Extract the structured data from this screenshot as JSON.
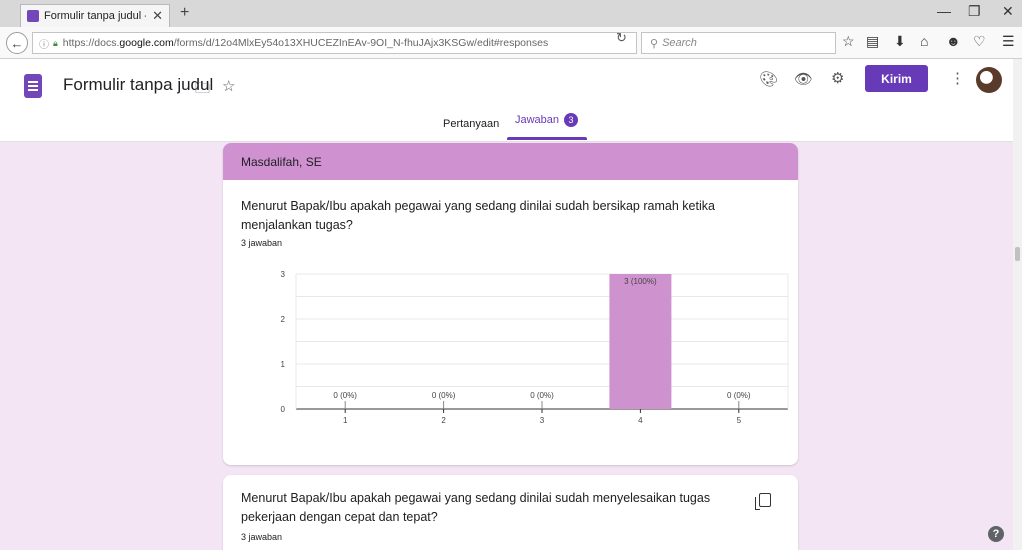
{
  "browser": {
    "tab_title": "Formulir tanpa judul - Go...",
    "tab_close": "✕",
    "new_tab": "+",
    "url_prefix": "https://docs.",
    "url_host": "google.com",
    "url_path": "/forms/d/12o4MlxEy54o13XHUCEZInEAv-9OI_N-fhuJAjx3KSGw/edit#responses",
    "search_placeholder": "Search"
  },
  "header": {
    "form_title": "Formulir tanpa judul",
    "send_label": "Kirim",
    "tab_questions": "Pertanyaan",
    "tab_responses": "Jawaban",
    "responses_badge": "3"
  },
  "cards": [
    {
      "section_title": "Masdalifah, SE",
      "question": "Menurut Bapak/Ibu apakah pegawai yang sedang dinilai sudah bersikap ramah ketika menjalankan tugas?",
      "response_count": "3 jawaban"
    },
    {
      "question": "Menurut Bapak/Ibu apakah pegawai yang sedang dinilai sudah menyelesaikan tugas pekerjaan dengan cepat dan tepat?",
      "response_count": "3 jawaban"
    }
  ],
  "colors": {
    "accent": "#673ab7",
    "section_header": "#d091d0",
    "bar": "#ce93ce",
    "background": "#f3e5f4"
  },
  "chart_data": {
    "type": "bar",
    "categories": [
      "1",
      "2",
      "3",
      "4",
      "5"
    ],
    "values": [
      0,
      0,
      0,
      3,
      0
    ],
    "data_labels": [
      "0 (0%)",
      "0 (0%)",
      "0 (0%)",
      "3 (100%)",
      "0 (0%)"
    ],
    "yticks": [
      "0",
      "1",
      "2",
      "3"
    ],
    "ylim": [
      0,
      3
    ],
    "grid": true,
    "title": "",
    "xlabel": "",
    "ylabel": ""
  }
}
